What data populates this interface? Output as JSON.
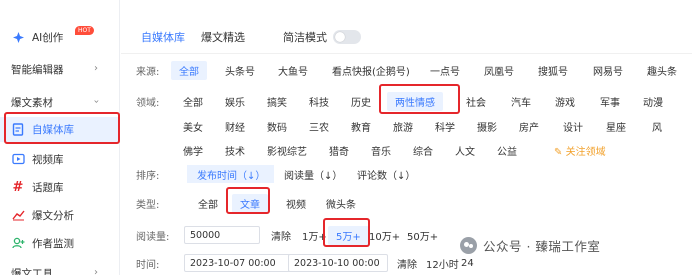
{
  "sidebar": {
    "items": [
      {
        "label": "AI创作",
        "badge": "HOT",
        "icon": "ai-icon"
      },
      {
        "label": "智能编辑器",
        "arrow": "›"
      },
      {
        "label": "爆文素材",
        "arrow": "›"
      },
      {
        "label": "自媒体库",
        "icon": "document-icon",
        "active": true
      },
      {
        "label": "视频库",
        "icon": "video-icon"
      },
      {
        "label": "话题库",
        "icon": "hash-icon"
      },
      {
        "label": "爆文分析",
        "icon": "chart-icon"
      },
      {
        "label": "作者监测",
        "icon": "user-add-icon"
      },
      {
        "label": "爆文工具",
        "arrow": "›"
      }
    ]
  },
  "tabs": [
    {
      "label": "自媒体库",
      "active": true
    },
    {
      "label": "爆文精选"
    },
    {
      "label": "简洁模式"
    }
  ],
  "source": {
    "label": "来源:",
    "options": [
      "全部",
      "头条号",
      "大鱼号",
      "看点快报(企鹅号)",
      "一点号",
      "凤凰号",
      "搜狐号",
      "网易号",
      "趣头条"
    ]
  },
  "field": {
    "label": "领域:",
    "row1": [
      "全部",
      "娱乐",
      "搞笑",
      "科技",
      "历史",
      "两性情感",
      "社会",
      "汽车",
      "游戏",
      "军事",
      "动漫"
    ],
    "row2": [
      "美女",
      "财经",
      "数码",
      "三农",
      "教育",
      "旅游",
      "科学",
      "摄影",
      "房产",
      "设计",
      "星座",
      "风"
    ],
    "row3": [
      "佛学",
      "技术",
      "影视综艺",
      "猎奇",
      "音乐",
      "综合",
      "人文",
      "公益"
    ],
    "follow": "关注领域"
  },
  "sort": {
    "label": "排序:",
    "options": [
      "发布时间（↓）",
      "阅读量（↓）",
      "评论数（↓）"
    ]
  },
  "type": {
    "label": "类型:",
    "options": [
      "全部",
      "文章",
      "视频",
      "微头条"
    ]
  },
  "reads": {
    "label": "阅读量:",
    "value": "50000",
    "clear": "清除",
    "options": [
      "1万+",
      "5万+",
      "10万+",
      "50万+"
    ]
  },
  "time": {
    "label": "时间:",
    "start": "2023-10-07 00:00",
    "end": "2023-10-10 00:00",
    "clear": "清除",
    "options": [
      "12小时",
      "24"
    ]
  },
  "watermark": "公众号 · 臻瑞工作室",
  "colors": {
    "accent": "#3a7afe",
    "highlight": "#e5262b",
    "selected_bg": "#eaf2ff"
  }
}
